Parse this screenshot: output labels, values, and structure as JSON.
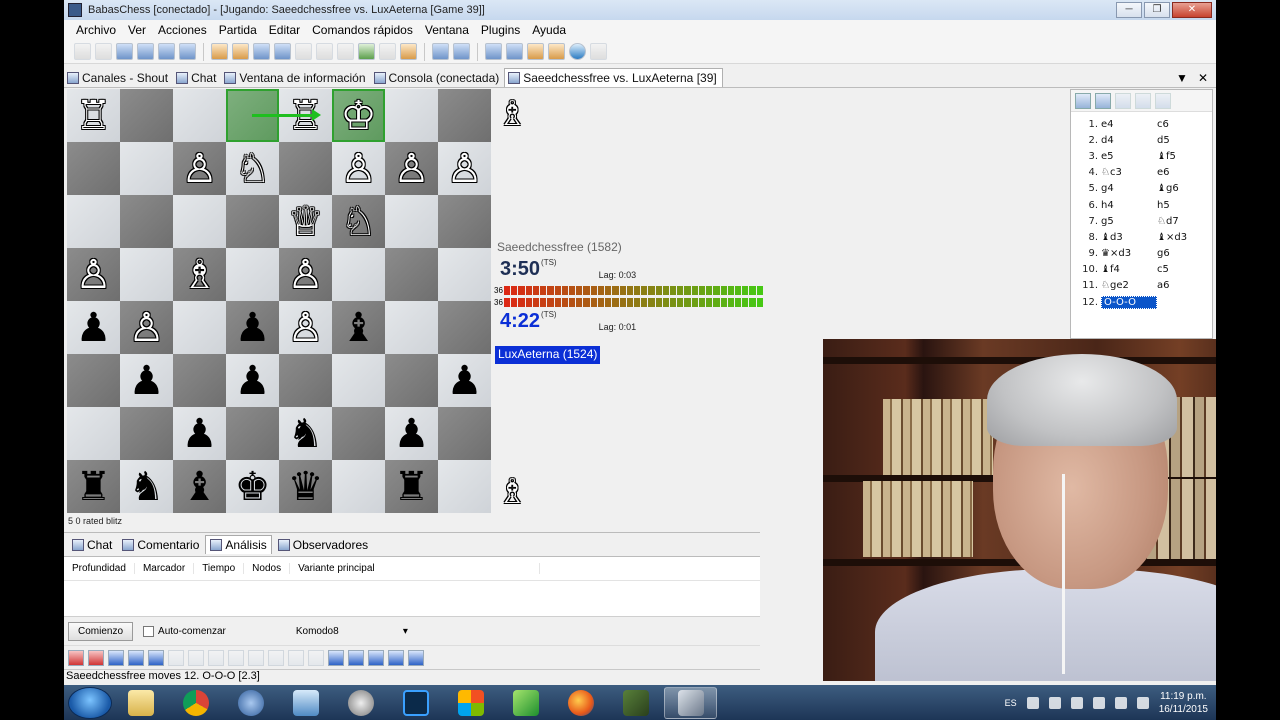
{
  "window": {
    "title": "BabasChess [conectado] - [Jugando: Saeedchessfree vs. LuxAeterna [Game 39]]",
    "minimize": "─",
    "maximize": "❐",
    "close": "✕"
  },
  "menu": [
    "Archivo",
    "Ver",
    "Acciones",
    "Partida",
    "Editar",
    "Comandos rápidos",
    "Ventana",
    "Plugins",
    "Ayuda"
  ],
  "tabs": [
    {
      "label": "Canales - Shout",
      "icon": "channels-icon"
    },
    {
      "label": "Chat",
      "icon": "chat-icon"
    },
    {
      "label": "Ventana de información",
      "icon": "info-window-icon"
    },
    {
      "label": "Consola (conectada)",
      "icon": "console-icon"
    },
    {
      "label": "Saeedchessfree vs. LuxAeterna [39]",
      "icon": "game-icon",
      "active": true
    }
  ],
  "tab_controls": {
    "dropdown": "▼",
    "close": "✕"
  },
  "board": {
    "ranks": [
      [
        "wR",
        "",
        "",
        "",
        "wR",
        "wK",
        "",
        ""
      ],
      [
        "",
        "",
        "wP",
        "wN",
        "",
        "wP",
        "wP",
        "wP"
      ],
      [
        "",
        "",
        "",
        "",
        "wQ",
        "wN",
        "",
        ""
      ],
      [
        "wP",
        "",
        "wB",
        "",
        "wP",
        "",
        "",
        ""
      ],
      [
        "bP",
        "wP",
        "",
        "bP",
        "wP",
        "bB",
        "",
        ""
      ],
      [
        "",
        "bP",
        "",
        "bP",
        "",
        "",
        "",
        "bP"
      ],
      [
        "",
        "",
        "bP",
        "",
        "bN",
        "",
        "bP",
        ""
      ],
      [
        "bR",
        "bN",
        "bB",
        "bK",
        "bQ",
        "",
        "bR",
        ""
      ]
    ],
    "highlight": [
      [
        0,
        3
      ],
      [
        0,
        5
      ]
    ],
    "game_type": "5 0 rated blitz",
    "captured_top": "wB",
    "captured_bottom": "wB"
  },
  "pieces": {
    "wK": "♔",
    "wQ": "♕",
    "wR": "♖",
    "wB": "♗",
    "wN": "♘",
    "wP": "♙",
    "bK": "♚",
    "bQ": "♛",
    "bR": "♜",
    "bB": "♝",
    "bN": "♞",
    "bP": "♟"
  },
  "clocks": {
    "white": {
      "name": "Saeedchessfree (1582)",
      "time": "3:50",
      "ts": "(TS)",
      "lag": "Lag: 0:03",
      "bar_label": "36"
    },
    "black": {
      "name": "LuxAeterna (1524)",
      "time": "4:22",
      "ts": "(TS)",
      "lag": "Lag: 0:01",
      "bar_label": "36"
    }
  },
  "moves": [
    {
      "n": "1.",
      "w": "e4",
      "b": "c6"
    },
    {
      "n": "2.",
      "w": "d4",
      "b": "d5"
    },
    {
      "n": "3.",
      "w": "e5",
      "b": "♝f5"
    },
    {
      "n": "4.",
      "w": "♘c3",
      "b": "e6"
    },
    {
      "n": "5.",
      "w": "g4",
      "b": "♝g6"
    },
    {
      "n": "6.",
      "w": "h4",
      "b": "h5"
    },
    {
      "n": "7.",
      "w": "g5",
      "b": "♘d7"
    },
    {
      "n": "8.",
      "w": "♝d3",
      "b": "♝×d3"
    },
    {
      "n": "9.",
      "w": "♛×d3",
      "b": "g6"
    },
    {
      "n": "10.",
      "w": "♝f4",
      "b": "c5"
    },
    {
      "n": "11.",
      "w": "♘ge2",
      "b": "a6"
    },
    {
      "n": "12.",
      "w": "O-O-O",
      "b": ""
    }
  ],
  "lower_tabs": [
    {
      "label": "Chat",
      "icon": "chat-icon"
    },
    {
      "label": "Comentario",
      "icon": "comment-icon"
    },
    {
      "label": "Análisis",
      "icon": "analysis-icon",
      "active": true
    },
    {
      "label": "Observadores",
      "icon": "observers-icon"
    }
  ],
  "analysis": {
    "columns": [
      "Profundidad",
      "Marcador",
      "Tiempo",
      "Nodos",
      "Variante principal"
    ],
    "start_button": "Comienzo",
    "auto_start": "Auto-comenzar",
    "engine": "Komodo8",
    "dropdown_arrow": "▾"
  },
  "status": "Saeedchessfree moves 12. O-O-O [2.3]",
  "taskbar": {
    "language": "ES",
    "time": "11:19 p.m.",
    "date": "16/11/2015"
  }
}
